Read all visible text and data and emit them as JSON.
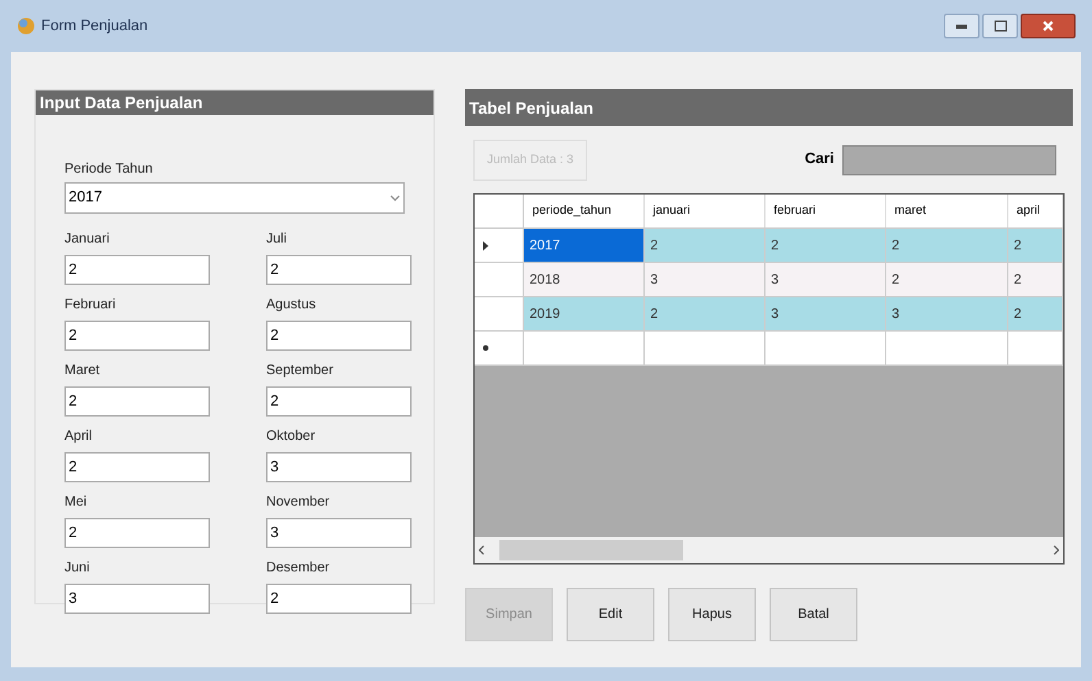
{
  "window": {
    "title": "Form Penjualan"
  },
  "input_panel": {
    "title": "Input Data Penjualan",
    "periode": {
      "label": "Periode Tahun",
      "value": "2017"
    },
    "months": [
      {
        "label": "Januari",
        "value": "2"
      },
      {
        "label": "Juli",
        "value": "2"
      },
      {
        "label": "Februari",
        "value": "2"
      },
      {
        "label": "Agustus",
        "value": "2"
      },
      {
        "label": "Maret",
        "value": "2"
      },
      {
        "label": "September",
        "value": "2"
      },
      {
        "label": "April",
        "value": "2"
      },
      {
        "label": "Oktober",
        "value": "3"
      },
      {
        "label": "Mei",
        "value": "2"
      },
      {
        "label": "November",
        "value": "3"
      },
      {
        "label": "Juni",
        "value": "3"
      },
      {
        "label": "Desember",
        "value": "2"
      }
    ]
  },
  "table_panel": {
    "title": "Tabel Penjualan",
    "count": "Jumlah Data : 3",
    "search_label": "Cari",
    "table": {
      "columns": [
        "periode_tahun",
        "januari",
        "februari",
        "maret",
        "april"
      ],
      "rows": [
        {
          "kind": "data",
          "selected": true,
          "cells": [
            "2017",
            "2",
            "2",
            "2",
            "2"
          ]
        },
        {
          "kind": "data",
          "selected": false,
          "cells": [
            "2018",
            "3",
            "3",
            "2",
            "2"
          ]
        },
        {
          "kind": "data",
          "selected": false,
          "cells": [
            "2019",
            "2",
            "3",
            "3",
            "2"
          ]
        },
        {
          "kind": "new",
          "selected": false,
          "cells": []
        }
      ]
    },
    "buttons": [
      {
        "label": "Simpan",
        "disabled": true
      },
      {
        "label": "Edit",
        "disabled": false
      },
      {
        "label": "Hapus",
        "disabled": false
      },
      {
        "label": "Batal",
        "disabled": false
      }
    ]
  }
}
